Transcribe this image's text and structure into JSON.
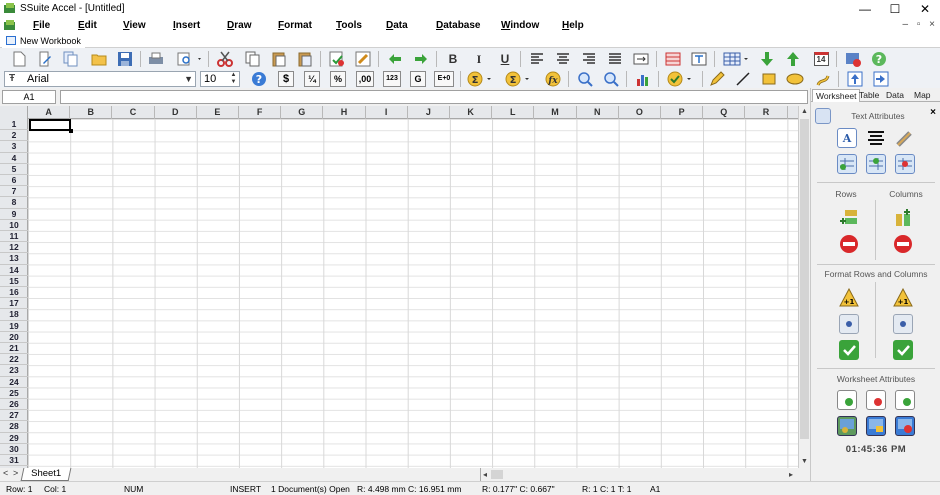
{
  "window": {
    "title": "SSuite Accel - [Untitled]",
    "minimize": "—",
    "maximize": "☐",
    "close": "✕"
  },
  "menu": [
    "File",
    "Edit",
    "View",
    "Insert",
    "Draw",
    "Format",
    "Tools",
    "Data",
    "Database",
    "Window",
    "Help"
  ],
  "mdi_controls": "– ▫ ×",
  "doc_tab": "New Workbook",
  "toolbar2": {
    "font_name": "Arial",
    "font_size": "10",
    "currency": "$",
    "fraction": "¼",
    "percent": "%",
    "decimals": ",00",
    "number": "123",
    "general": "G",
    "exponent": "E+0"
  },
  "toolbar1": {
    "bold": "B",
    "italic": "I",
    "underline": "U",
    "calendar_day": "14"
  },
  "formula_bar": {
    "cell_ref": "A1",
    "formula": ""
  },
  "columns": [
    "A",
    "B",
    "C",
    "D",
    "E",
    "F",
    "G",
    "H",
    "I",
    "J",
    "K",
    "L",
    "M",
    "N",
    "O",
    "P",
    "Q",
    "R"
  ],
  "rows": [
    "1",
    "2",
    "3",
    "4",
    "5",
    "6",
    "7",
    "8",
    "9",
    "10",
    "11",
    "12",
    "13",
    "14",
    "15",
    "16",
    "17",
    "18",
    "19",
    "20",
    "21",
    "22",
    "23",
    "24",
    "25",
    "26",
    "27",
    "28",
    "29",
    "30",
    "31"
  ],
  "sheet": {
    "nav_prev": "<",
    "nav_next": ">",
    "tab": "Sheet1"
  },
  "status": {
    "row": "Row:  1",
    "col": "Col:  1",
    "num": "NUM",
    "insert": "INSERT",
    "docs": "1 Document(s) Open",
    "rc_mm": "R: 4.498 mm   C: 16.951 mm",
    "rc_in": "R: 0.177\"   C: 0.667\"",
    "rct": "R: 1   C: 1   T: 1",
    "cell": "A1"
  },
  "side_panel": {
    "tabs": [
      "Worksheet",
      "Table",
      "Data",
      "Map"
    ],
    "close": "×",
    "text_attributes": "Text Attributes",
    "rows": "Rows",
    "columns": "Columns",
    "format_rows_columns": "Format Rows and Columns",
    "worksheet_attributes": "Worksheet Attributes",
    "clock": "01:45:36 PM"
  }
}
